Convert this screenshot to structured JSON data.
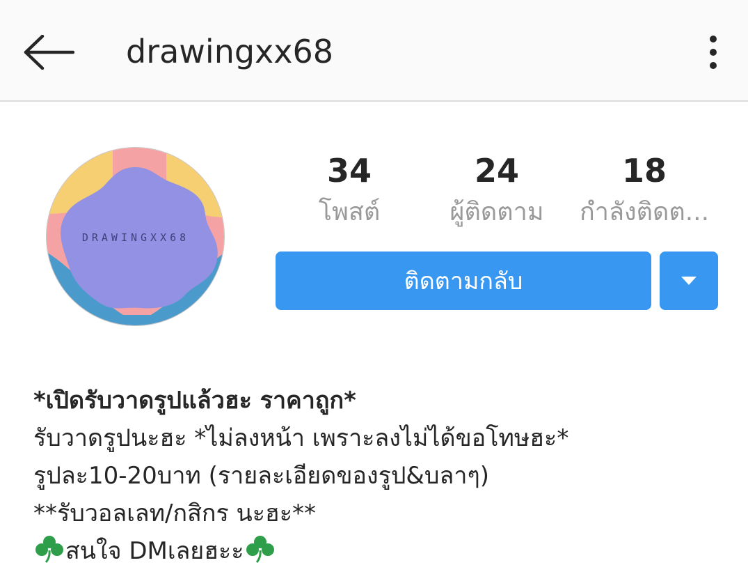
{
  "header": {
    "username": "drawingxx68"
  },
  "avatar": {
    "text": "DRAWINGXX68",
    "colors": {
      "background": "#f4a2a3",
      "center": "#9391e4",
      "yellow": "#f5cf71",
      "blue": "#4a9bcb"
    }
  },
  "stats": [
    {
      "value": "34",
      "label": "โพสต์"
    },
    {
      "value": "24",
      "label": "ผู้ติดตาม"
    },
    {
      "value": "18",
      "label": "กำลังติดต..."
    }
  ],
  "actions": {
    "follow_back_label": "ติดตามกลับ"
  },
  "bio": {
    "line1": "*เปิดรับวาดรูปแล้วฮะ ราคาถูก*",
    "line2": "รับวาดรูปนะฮะ *ไม่ลงหน้า เพราะลงไม่ได้ขอโทษฮะ*",
    "line3": "รูปละ10-20บาท (รายละเอียดของรูป&บลาๆ)",
    "line4": "**รับวอลเลท/กสิกร นะฮะ**",
    "line5": "สนใจ DMเลยฮะะ"
  },
  "colors": {
    "accent": "#3897f0",
    "text": "#262626",
    "muted": "#999999",
    "clover": "#2e9e4a"
  }
}
